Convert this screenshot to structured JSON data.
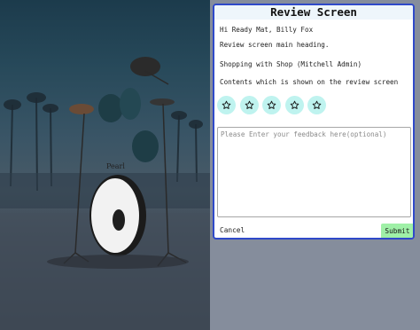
{
  "dialog": {
    "title": "Review Screen",
    "greeting": "Hi Ready Mat, Billy Fox",
    "heading": "Review screen main heading.",
    "shopping": "Shopping with Shop (Mitchell Admin)",
    "contents": "Contents which is shown on the review screen",
    "rating": {
      "max": 5,
      "selected": 0
    },
    "feedback_placeholder": "Please Enter your feedback here(optional)",
    "feedback_value": "",
    "cancel_label": "Cancel",
    "submit_label": "Submit"
  },
  "colors": {
    "dialog_border": "#2f49c9",
    "header_bg": "#eef6fb",
    "star_bg": "#bff3ef",
    "submit_bg": "#9ff0a7",
    "page_bg": "#858d9c"
  },
  "background_image": {
    "subject": "drum kit on a street at dusk"
  }
}
